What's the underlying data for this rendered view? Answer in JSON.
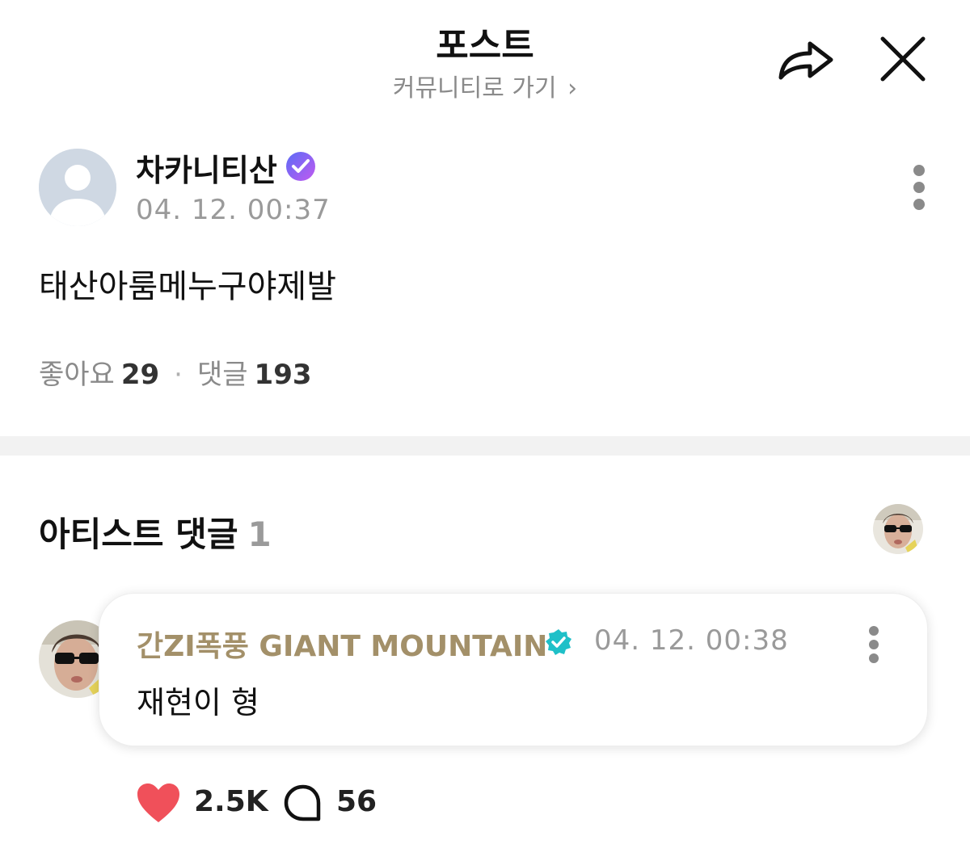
{
  "header": {
    "title": "포스트",
    "subtitle": "커뮤니티로 가기",
    "subtitle_chevron": "›",
    "share_icon": "share-arrow-icon",
    "close_icon": "close-icon"
  },
  "post": {
    "author": "차카니티산",
    "verified_icon": "verified-badge-icon",
    "date": "04. 12. 00:37",
    "body": "태산아룸메누구야제발",
    "likes_label": "좋아요",
    "likes_count": "29",
    "separator": "·",
    "comments_label": "댓글",
    "comments_count": "193"
  },
  "artist_comments": {
    "heading": "아티스트 댓글",
    "count": "1",
    "items": [
      {
        "author": "간ZI폭풍 GIANT MOUNTAIN",
        "date": "04. 12. 00:38",
        "text": "재현이 형",
        "likes": "2.5K",
        "replies": "56"
      }
    ]
  },
  "colors": {
    "artist_name": "#a39069",
    "like_heart": "#f0505a",
    "verified_post_gradient": [
      "#5b6cf6",
      "#c15af0"
    ],
    "verified_artist": "#1fc0c8",
    "divider": "#f2f2f2"
  }
}
